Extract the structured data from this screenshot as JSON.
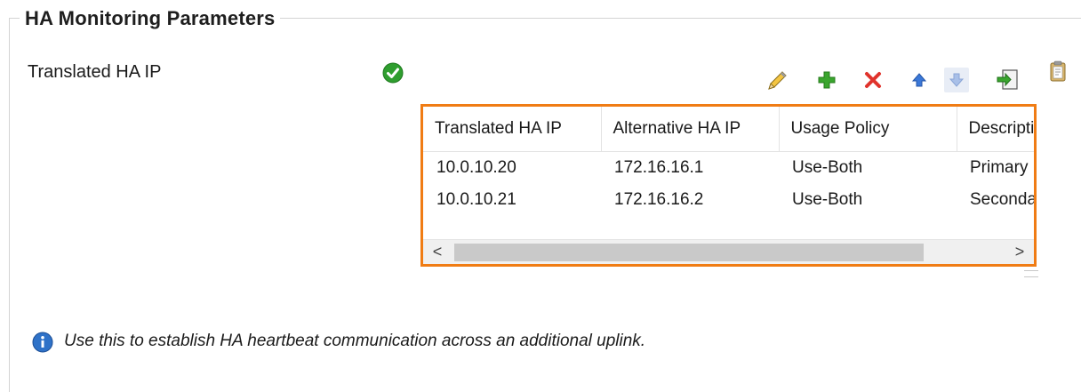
{
  "section": {
    "title": "HA Monitoring Parameters"
  },
  "field": {
    "label": "Translated HA IP",
    "status": "ok"
  },
  "toolbar": {
    "buttons": [
      {
        "name": "edit",
        "icon": "pencil-icon"
      },
      {
        "name": "add",
        "icon": "plus-icon"
      },
      {
        "name": "delete",
        "icon": "red-x-icon"
      },
      {
        "name": "move-up",
        "icon": "arrow-up-icon"
      },
      {
        "name": "move-down",
        "icon": "arrow-down-icon",
        "disabled": true
      },
      {
        "name": "import",
        "icon": "import-icon"
      },
      {
        "name": "clipboard",
        "icon": "clipboard-icon"
      }
    ]
  },
  "table": {
    "columns": [
      "Translated HA IP",
      "Alternative HA IP",
      "Usage Policy",
      "Description"
    ],
    "rows": [
      [
        "10.0.10.20",
        "172.16.16.1",
        "Use-Both",
        "Primary"
      ],
      [
        "10.0.10.21",
        "172.16.16.2",
        "Use-Both",
        "Secondary"
      ]
    ],
    "scrollbar": {
      "left": "<",
      "right": ">"
    }
  },
  "info": {
    "text": "Use this to establish HA heartbeat communication across an additional uplink."
  },
  "colors": {
    "highlight_border": "#f07c14",
    "ok_green": "#2f9e2f",
    "info_blue": "#2f72c8",
    "delete_red": "#e0332c"
  }
}
